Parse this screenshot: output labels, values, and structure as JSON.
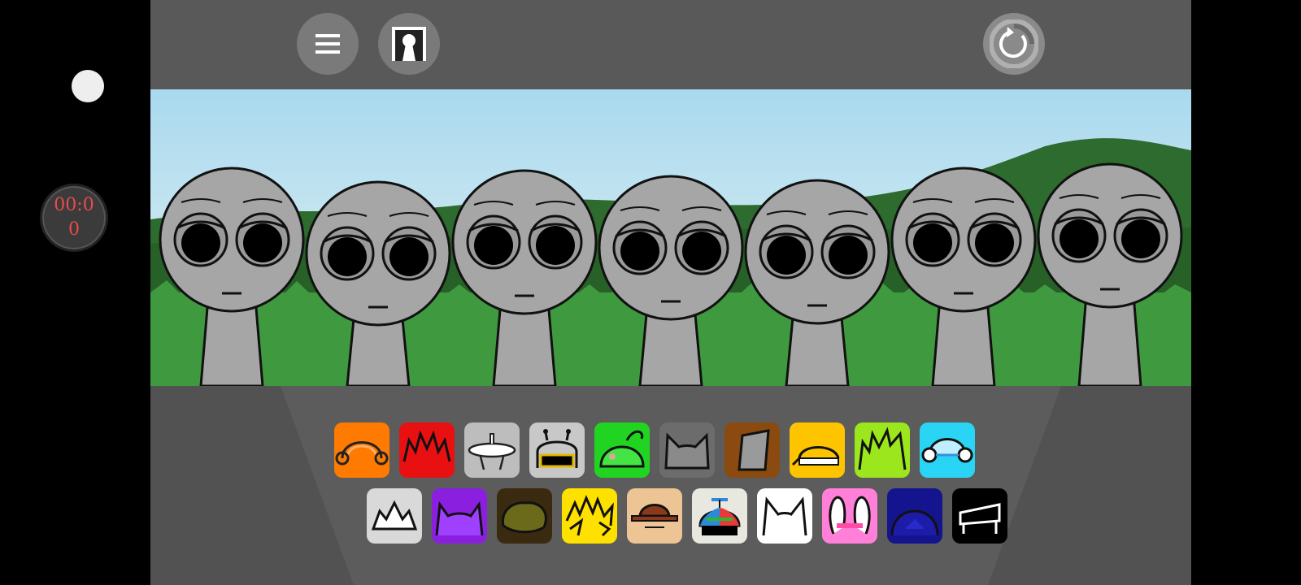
{
  "overlay": {
    "timer_line1": "00:0",
    "timer_line2": "0"
  },
  "toolbar": {
    "buttons": [
      {
        "icon": "menu-icon"
      },
      {
        "icon": "door-icon"
      },
      {
        "icon": "reset-icon"
      }
    ]
  },
  "stage": {
    "characters": 7,
    "colors": {
      "sky": "#a9d9ee",
      "grass": "#3f9a3f",
      "hill": "#2e6b2e",
      "character": "#a6a6a6",
      "background": "#595959"
    }
  },
  "tray": {
    "row1": [
      {
        "icon": "orange-headphones-icon",
        "color": "#ff7a00"
      },
      {
        "icon": "red-spiky-hair-icon",
        "color": "#e81010"
      },
      {
        "icon": "silver-halo-icon",
        "color": "#bdbdbd"
      },
      {
        "icon": "robot-visor-icon",
        "color": "#c8c8c8"
      },
      {
        "icon": "green-beanie-icon",
        "color": "#22d422"
      },
      {
        "icon": "gray-cat-ears-icon",
        "color": "#6c6c6c"
      },
      {
        "icon": "brown-bucket-hat-icon",
        "color": "#8a4a10"
      },
      {
        "icon": "yellow-cap-icon",
        "color": "#ffc400"
      },
      {
        "icon": "lime-spiky-hair-icon",
        "color": "#9be61c"
      },
      {
        "icon": "cyan-headphones-icon",
        "color": "#2ad4f4"
      }
    ],
    "row2": [
      {
        "icon": "white-crown-icon",
        "color": "#d9d9d9"
      },
      {
        "icon": "purple-horns-icon",
        "color": "#8a1fe0"
      },
      {
        "icon": "olive-bush-hair-icon",
        "color": "#3a2a10"
      },
      {
        "icon": "yellow-lightning-icon",
        "color": "#ffe100"
      },
      {
        "icon": "fedora-icon",
        "color": "#edc493"
      },
      {
        "icon": "propeller-hat-icon",
        "color": "#e8e8e0"
      },
      {
        "icon": "white-cat-ears-icon",
        "color": "#ffffff"
      },
      {
        "icon": "pink-bunny-ears-icon",
        "color": "#ff7fd9"
      },
      {
        "icon": "navy-hood-icon",
        "color": "#14148f"
      },
      {
        "icon": "black-bench-icon",
        "color": "#000000"
      }
    ]
  }
}
